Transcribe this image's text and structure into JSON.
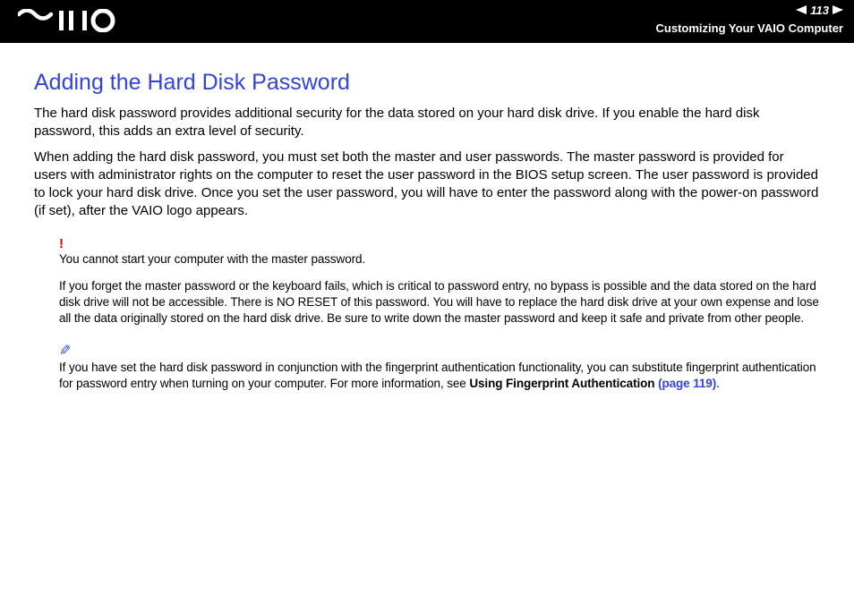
{
  "header": {
    "page_number": "113",
    "breadcrumb": "Customizing Your VAIO Computer"
  },
  "main": {
    "title": "Adding the Hard Disk Password",
    "para1": "The hard disk password provides additional security for the data stored on your hard disk drive. If you enable the hard disk password, this adds an extra level of security.",
    "para2": "When adding the hard disk password, you must set both the master and user passwords. The master password is provided for users with administrator rights on the computer to reset the user password in the BIOS setup screen. The user password is provided to lock your hard disk drive. Once you set the user password, you will have to enter the password along with the power-on password (if set), after the VAIO logo appears.",
    "warning": {
      "line1": "You cannot start your computer with the master password.",
      "line2": "If you forget the master password or the keyboard fails, which is critical to password entry, no bypass is possible and the data stored on the hard disk drive will not be accessible. There is NO RESET of this password. You will have to replace the hard disk drive at your own expense and lose all the data originally stored on the hard disk drive. Be sure to write down the master password and keep it safe and private from other people."
    },
    "tip": {
      "text_before": "If you have set the hard disk password in conjunction with the fingerprint authentication functionality, you can substitute fingerprint authentication for password entry when turning on your computer. For more information, see ",
      "link_bold": "Using Fingerprint Authentication ",
      "link_page": "(page 119)",
      "text_after": "."
    }
  }
}
